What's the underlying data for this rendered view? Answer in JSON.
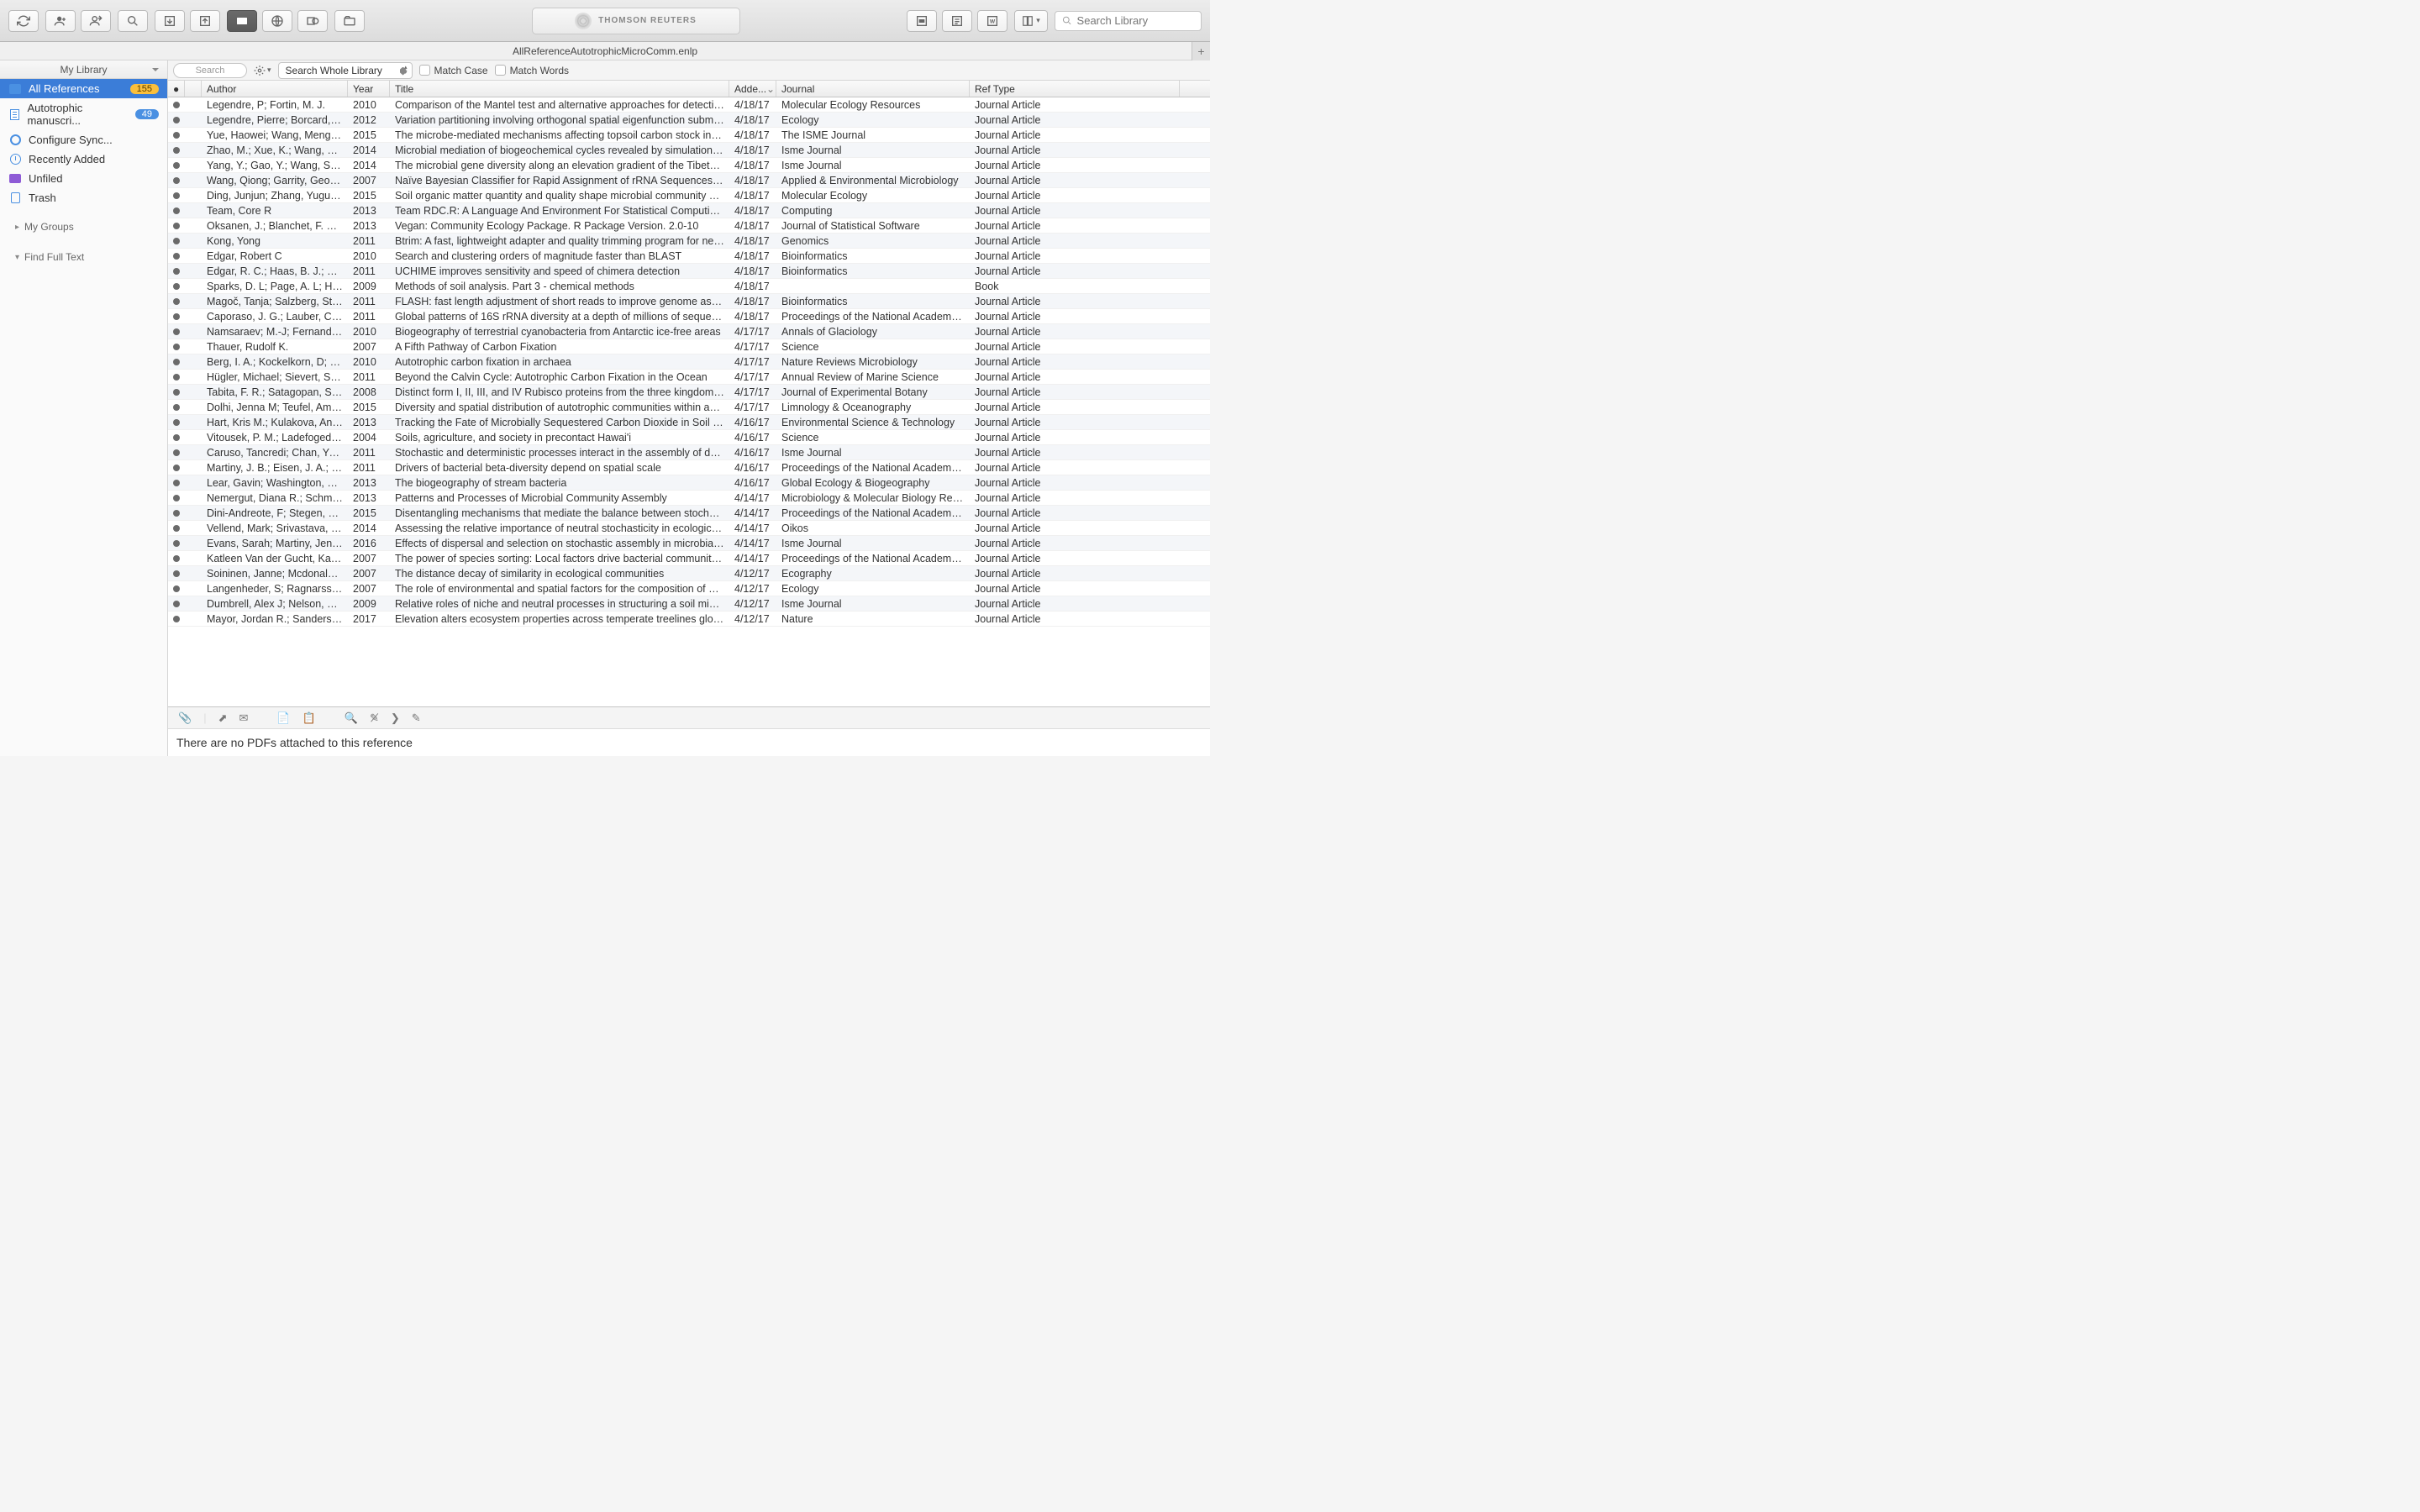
{
  "brand": "THOMSON REUTERS",
  "window_title": "AllReferenceAutotrophicMicroComm.enlp",
  "search_placeholder": "Search Library",
  "sidebar": {
    "header": "My Library",
    "items": [
      {
        "label": "All References",
        "badge": "155",
        "selected": true
      },
      {
        "label": "Autotrophic manuscri...",
        "badge": "49"
      },
      {
        "label": "Configure Sync..."
      },
      {
        "label": "Recently Added"
      },
      {
        "label": "Unfiled"
      },
      {
        "label": "Trash"
      }
    ],
    "groups": [
      "My Groups",
      "Find Full Text"
    ]
  },
  "searchbar": {
    "placeholder": "Search",
    "scope": "Search Whole Library",
    "match_case": "Match Case",
    "match_words": "Match Words"
  },
  "columns": {
    "author": "Author",
    "year": "Year",
    "title": "Title",
    "added": "Adde...",
    "journal": "Journal",
    "ref": "Ref Type"
  },
  "rows": [
    {
      "author": "Legendre, P; Fortin, M. J.",
      "year": "2010",
      "title": "Comparison of the Mantel test and alternative approaches for detecting co...",
      "added": "4/18/17",
      "journal": "Molecular Ecology Resources",
      "ref": "Journal Article"
    },
    {
      "author": "Legendre, Pierre; Borcard, Da...",
      "year": "2012",
      "title": "Variation partitioning involving orthogonal spatial eigenfunction submodels",
      "added": "4/18/17",
      "journal": "Ecology",
      "ref": "Journal Article"
    },
    {
      "author": "Yue, Haowei; Wang, Mengme...",
      "year": "2015",
      "title": "The microbe-mediated mechanisms affecting topsoil carbon stock in Tibeta...",
      "added": "4/18/17",
      "journal": "The ISME Journal",
      "ref": "Journal Article"
    },
    {
      "author": "Zhao, M.; Xue, K.; Wang, F.; Li...",
      "year": "2014",
      "title": "Microbial mediation of biogeochemical cycles revealed by simulation of glob...",
      "added": "4/18/17",
      "journal": "Isme Journal",
      "ref": "Journal Article"
    },
    {
      "author": "Yang, Y.; Gao, Y.; Wang, S.; X...",
      "year": "2014",
      "title": "The microbial gene diversity along an elevation gradient of the Tibetan gras...",
      "added": "4/18/17",
      "journal": "Isme Journal",
      "ref": "Journal Article"
    },
    {
      "author": "Wang, Qiong; Garrity, George...",
      "year": "2007",
      "title": "Naïve Bayesian Classifier for Rapid Assignment of rRNA Sequences into th...",
      "added": "4/18/17",
      "journal": "Applied & Environmental Microbiology",
      "ref": "Journal Article"
    },
    {
      "author": "Ding, Junjun; Zhang, Yuguang...",
      "year": "2015",
      "title": "Soil organic matter quantity and quality shape microbial community compos...",
      "added": "4/18/17",
      "journal": "Molecular Ecology",
      "ref": "Journal Article"
    },
    {
      "author": "Team, Core R",
      "year": "2013",
      "title": "Team RDC.R: A Language And Environment For Statistical Computing. R F...",
      "added": "4/18/17",
      "journal": "Computing",
      "ref": "Journal Article"
    },
    {
      "author": "Oksanen, J.; Blanchet, F. G.;...",
      "year": "2013",
      "title": "Vegan: Community Ecology Package. R Package Version. 2.0-10",
      "added": "4/18/17",
      "journal": "Journal of Statistical Software",
      "ref": "Journal Article"
    },
    {
      "author": "Kong, Yong",
      "year": "2011",
      "title": "Btrim: A fast, lightweight adapter and quality trimming program for next-gen...",
      "added": "4/18/17",
      "journal": "Genomics",
      "ref": "Journal Article"
    },
    {
      "author": "Edgar, Robert C",
      "year": "2010",
      "title": "Search and clustering orders of magnitude faster than BLAST",
      "added": "4/18/17",
      "journal": "Bioinformatics",
      "ref": "Journal Article"
    },
    {
      "author": "Edgar, R. C.; Haas, B. J.; Cle...",
      "year": "2011",
      "title": "UCHIME improves sensitivity and speed of chimera detection",
      "added": "4/18/17",
      "journal": "Bioinformatics",
      "ref": "Journal Article"
    },
    {
      "author": "Sparks, D. L; Page, A. L; Helm...",
      "year": "2009",
      "title": "Methods of soil analysis. Part 3 - chemical methods",
      "added": "4/18/17",
      "journal": "",
      "ref": "Book"
    },
    {
      "author": "Magoč, Tanja; Salzberg, Steve...",
      "year": "2011",
      "title": "FLASH: fast length adjustment of short reads to improve genome assemblies",
      "added": "4/18/17",
      "journal": "Bioinformatics",
      "ref": "Journal Article"
    },
    {
      "author": "Caporaso, J. G.; Lauber, C. L.;...",
      "year": "2011",
      "title": "Global patterns of 16S rRNA diversity at a depth of millions of sequences p...",
      "added": "4/18/17",
      "journal": "Proceedings of the National Academy of...",
      "ref": "Journal Article"
    },
    {
      "author": "Namsaraev; M.-J; Fernandez;...",
      "year": "2010",
      "title": "Biogeography of terrestrial cyanobacteria from Antarctic ice-free areas",
      "added": "4/17/17",
      "journal": "Annals of Glaciology",
      "ref": "Journal Article"
    },
    {
      "author": "Thauer, Rudolf K.",
      "year": "2007",
      "title": "A Fifth Pathway of Carbon Fixation",
      "added": "4/17/17",
      "journal": "Science",
      "ref": "Journal Article"
    },
    {
      "author": "Berg, I. A.; Kockelkorn, D; Ra...",
      "year": "2010",
      "title": "Autotrophic carbon fixation in archaea",
      "added": "4/17/17",
      "journal": "Nature Reviews Microbiology",
      "ref": "Journal Article"
    },
    {
      "author": "Hügler, Michael; Sievert, Stefa...",
      "year": "2011",
      "title": "Beyond the Calvin Cycle: Autotrophic Carbon Fixation in the Ocean",
      "added": "4/17/17",
      "journal": "Annual Review of Marine Science",
      "ref": "Journal Article"
    },
    {
      "author": "Tabita, F. R.; Satagopan, S; H...",
      "year": "2008",
      "title": "Distinct form I, II, III, and IV Rubisco proteins from the three kingdoms of life...",
      "added": "4/17/17",
      "journal": "Journal of Experimental Botany",
      "ref": "Journal Article"
    },
    {
      "author": "Dolhi, Jenna M; Teufel, Amber...",
      "year": "2015",
      "title": "Diversity and spatial distribution of autotrophic communities within and betw...",
      "added": "4/17/17",
      "journal": "Limnology & Oceanography",
      "ref": "Journal Article"
    },
    {
      "author": "Hart, Kris M.; Kulakova, Anna...",
      "year": "2013",
      "title": "Tracking the Fate of Microbially Sequestered Carbon Dioxide in Soil Organi...",
      "added": "4/16/17",
      "journal": "Environmental Science & Technology",
      "ref": "Journal Article"
    },
    {
      "author": "Vitousek, P. M.; Ladefoged, T....",
      "year": "2004",
      "title": "Soils, agriculture, and society in precontact Hawai'i",
      "added": "4/16/17",
      "journal": "Science",
      "ref": "Journal Article"
    },
    {
      "author": "Caruso, Tancredi; Chan, Yuki;...",
      "year": "2011",
      "title": "Stochastic and deterministic processes interact in the assembly of desert mi...",
      "added": "4/16/17",
      "journal": "Isme Journal",
      "ref": "Journal Article"
    },
    {
      "author": "Martiny, J. B.; Eisen, J. A.; Pe...",
      "year": "2011",
      "title": "Drivers of bacterial beta-diversity depend on spatial scale",
      "added": "4/16/17",
      "journal": "Proceedings of the National Academy of...",
      "ref": "Journal Article"
    },
    {
      "author": "Lear, Gavin; Washington, Vidy...",
      "year": "2013",
      "title": "The biogeography of stream bacteria",
      "added": "4/16/17",
      "journal": "Global Ecology & Biogeography",
      "ref": "Journal Article"
    },
    {
      "author": "Nemergut, Diana R.; Schmidt,...",
      "year": "2013",
      "title": "Patterns and Processes of Microbial Community Assembly",
      "added": "4/14/17",
      "journal": "Microbiology & Molecular Biology Reviews",
      "ref": "Journal Article"
    },
    {
      "author": "Dini-Andreote, F; Stegen, J. C...",
      "year": "2015",
      "title": "Disentangling mechanisms that mediate the balance between stochastic an...",
      "added": "4/14/17",
      "journal": "Proceedings of the National Academy of...",
      "ref": "Journal Article"
    },
    {
      "author": "Vellend, Mark; Srivastava, Dia...",
      "year": "2014",
      "title": "Assessing the relative importance of neutral stochasticity in ecological com...",
      "added": "4/14/17",
      "journal": "Oikos",
      "ref": "Journal Article"
    },
    {
      "author": "Evans, Sarah; Martiny, Jennife...",
      "year": "2016",
      "title": "Effects of dispersal and selection on stochastic assembly in microbial comm...",
      "added": "4/14/17",
      "journal": "Isme Journal",
      "ref": "Journal Article"
    },
    {
      "author": "Katleen Van der Gucht, Karl C...",
      "year": "2007",
      "title": "The power of species sorting: Local factors drive bacterial community comp...",
      "added": "4/14/17",
      "journal": "Proceedings of the National Academy of...",
      "ref": "Journal Article"
    },
    {
      "author": "Soininen, Janne; Mcdonald, R...",
      "year": "2007",
      "title": "The distance decay of similarity in ecological communities",
      "added": "4/12/17",
      "journal": "Ecography",
      "ref": "Journal Article"
    },
    {
      "author": "Langenheder, S; Ragnarsson, H",
      "year": "2007",
      "title": "The role of environmental and spatial factors for the composition of aquatic...",
      "added": "4/12/17",
      "journal": "Ecology",
      "ref": "Journal Article"
    },
    {
      "author": "Dumbrell, Alex J; Nelson, Mich...",
      "year": "2009",
      "title": "Relative roles of niche and neutral processes in structuring a soil microbial...",
      "added": "4/12/17",
      "journal": "Isme Journal",
      "ref": "Journal Article"
    },
    {
      "author": "Mayor, Jordan R.; Sanders, N...",
      "year": "2017",
      "title": "Elevation alters ecosystem properties across temperate treelines globally",
      "added": "4/12/17",
      "journal": "Nature",
      "ref": "Journal Article"
    }
  ],
  "bottom_message": "There are no PDFs attached to this reference"
}
